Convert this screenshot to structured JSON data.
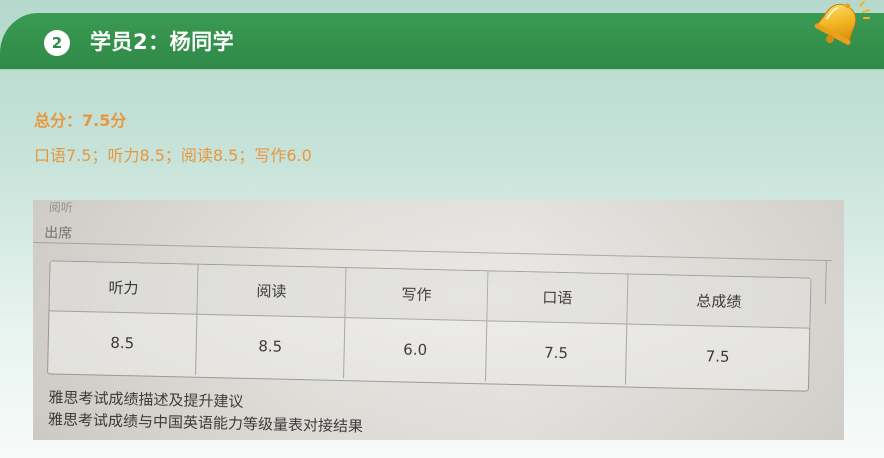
{
  "header": {
    "badge_number": "2",
    "title": "学员2：杨同学",
    "bell_icon": "bell-icon"
  },
  "summary": {
    "total": "总分：7.5分",
    "detail": "口语7.5；听力8.5；阅读8.5；写作6.0"
  },
  "photo": {
    "top_faint": "阅听",
    "attendance": "出席",
    "table": {
      "headers": [
        "听力",
        "阅读",
        "写作",
        "口语",
        "总成绩"
      ],
      "values": [
        "8.5",
        "8.5",
        "6.0",
        "7.5",
        "7.5"
      ]
    },
    "links": [
      "雅思考试成绩描述及提升建议",
      "雅思考试成绩与中国英语能力等级量表对接结果"
    ]
  },
  "colors": {
    "header_green": "#2f8a47",
    "accent_orange": "#e7983f",
    "bell_gold": "#f2b624"
  }
}
